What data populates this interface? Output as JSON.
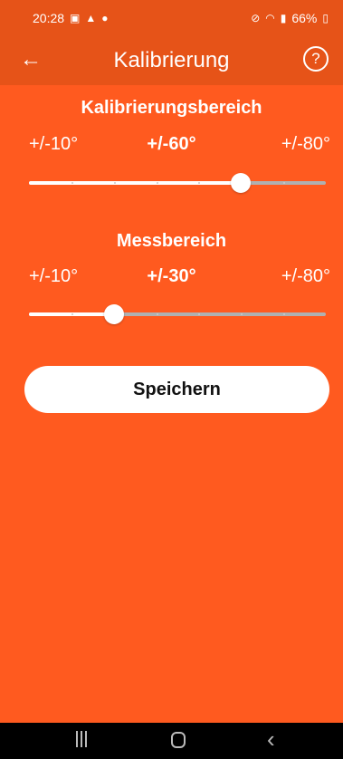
{
  "status_bar": {
    "time": "20:28",
    "battery": "66%",
    "left_icons": [
      "gallery-icon",
      "warning-icon",
      "location-icon"
    ],
    "right_icons": [
      "mute-icon",
      "wifi-icon",
      "signal-icon",
      "battery-icon"
    ]
  },
  "app_bar": {
    "title": "Kalibrierung",
    "back_icon": "arrow-left-icon",
    "help_icon": "help-circle-icon",
    "help_glyph": "?"
  },
  "calibration": {
    "title": "Kalibrierungsbereich",
    "min_label": "+/-10°",
    "current_label": "+/-60°",
    "max_label": "+/-80°",
    "value": 60,
    "min": 10,
    "max": 80
  },
  "measurement": {
    "title": "Messbereich",
    "min_label": "+/-10°",
    "current_label": "+/-30°",
    "max_label": "+/-80°",
    "value": 30,
    "min": 10,
    "max": 80
  },
  "save_button": {
    "label": "Speichern"
  },
  "colors": {
    "background": "#ff5a1f",
    "app_bar": "#e65318",
    "track_inactive": "#b0b0b0",
    "track_active": "#ffffff"
  }
}
